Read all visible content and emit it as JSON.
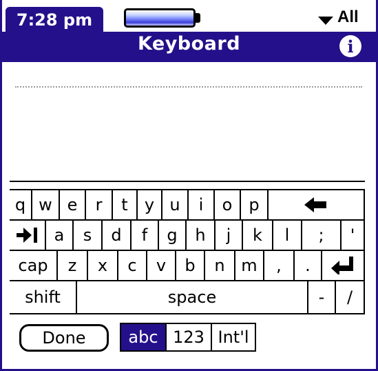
{
  "status": {
    "time": "7:28 pm",
    "category": "All"
  },
  "title": "Keyboard",
  "info_icon": "i",
  "keyboard": {
    "row1": [
      "q",
      "w",
      "e",
      "r",
      "t",
      "y",
      "u",
      "i",
      "o",
      "p"
    ],
    "row2": [
      "a",
      "s",
      "d",
      "f",
      "g",
      "h",
      "j",
      "k",
      "l",
      ";",
      "'"
    ],
    "row3": [
      "z",
      "x",
      "c",
      "v",
      "b",
      "n",
      "m",
      ",",
      "."
    ],
    "cap": "cap",
    "shift": "shift",
    "space": "space",
    "dash": "-",
    "slash": "/"
  },
  "buttons": {
    "done": "Done",
    "abc": "abc",
    "num": "123",
    "intl": "Int'l"
  },
  "colors": {
    "accent": "#24108a"
  },
  "icons": {
    "backspace": "backspace-icon",
    "tab": "tab-icon",
    "return": "return-icon"
  }
}
